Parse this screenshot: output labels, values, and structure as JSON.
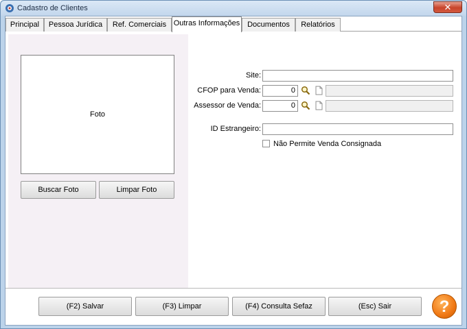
{
  "window": {
    "title": "Cadastro de Clientes",
    "close_label": "✕"
  },
  "tabs": [
    {
      "label": "Principal"
    },
    {
      "label": "Pessoa Jurídica"
    },
    {
      "label": "Ref. Comerciais"
    },
    {
      "label": "Outras Informações"
    },
    {
      "label": "Documentos"
    },
    {
      "label": "Relatórios"
    }
  ],
  "photo": {
    "label": "Foto",
    "browse_button": "Buscar Foto",
    "clear_button": "Limpar Foto"
  },
  "form": {
    "site": {
      "label": "Site:",
      "value": ""
    },
    "cfop": {
      "label": "CFOP para Venda:",
      "value": "0",
      "description": ""
    },
    "assessor": {
      "label": "Assessor de Venda:",
      "value": "0",
      "description": ""
    },
    "id_estrangeiro": {
      "label": "ID Estrangeiro:",
      "value": ""
    },
    "consignada": {
      "label": "Não Permite Venda Consignada",
      "checked": false
    }
  },
  "footer": {
    "save": "(F2) Salvar",
    "clear": "(F3) Limpar",
    "sefaz": "(F4) Consulta Sefaz",
    "exit": "(Esc) Sair",
    "help": "?"
  }
}
